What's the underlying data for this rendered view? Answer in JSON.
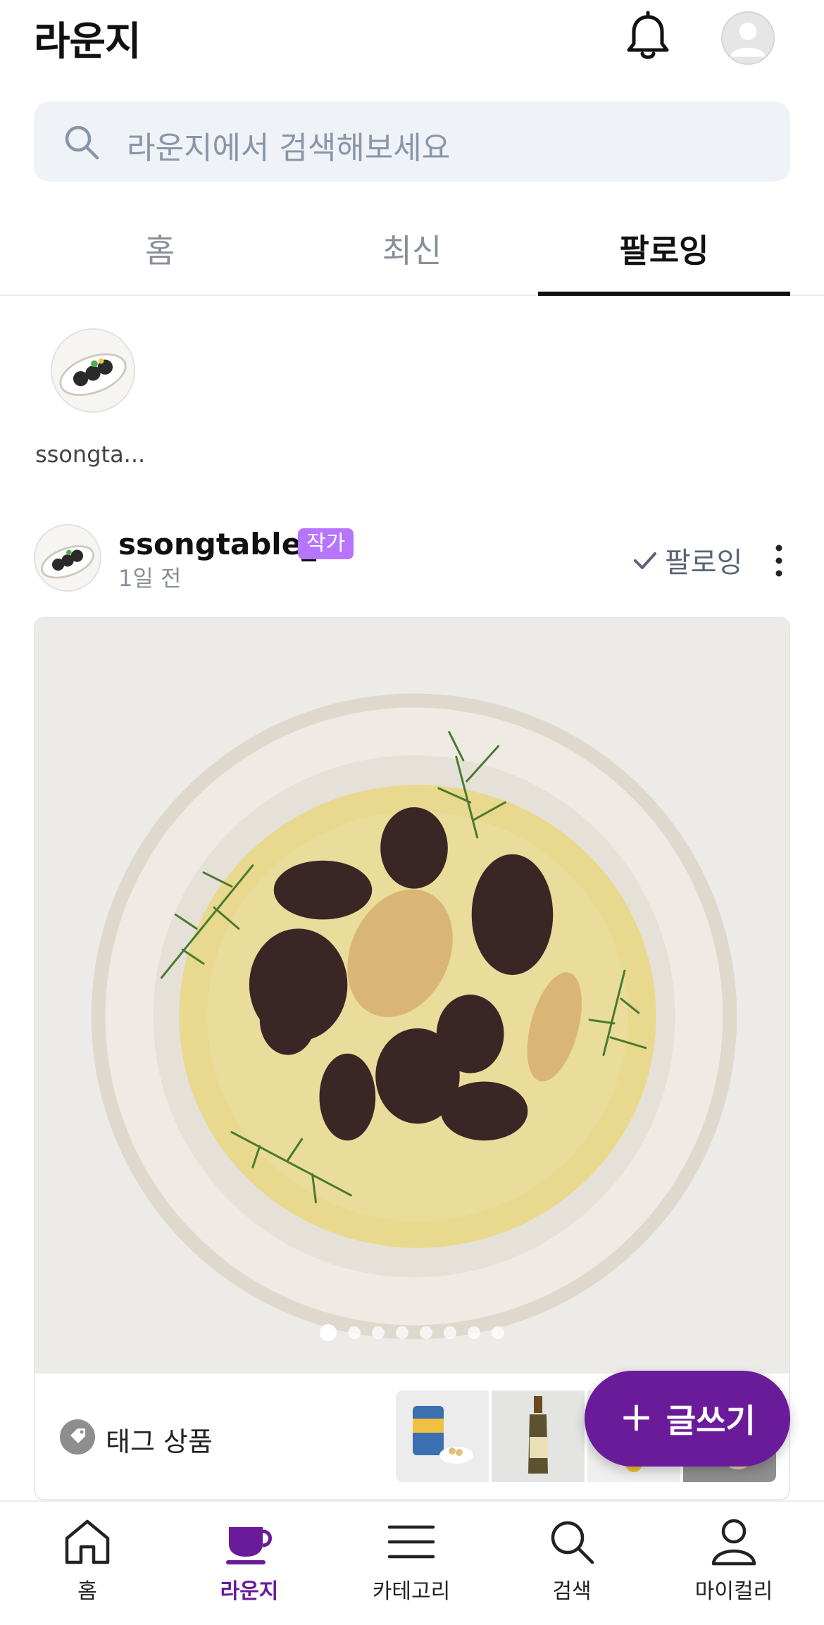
{
  "header": {
    "title": "라운지"
  },
  "search": {
    "placeholder": "라운지에서 검색해보세요"
  },
  "tabs": [
    {
      "label": "홈",
      "active": false
    },
    {
      "label": "최신",
      "active": false
    },
    {
      "label": "팔로잉",
      "active": true
    }
  ],
  "stories": [
    {
      "name": "ssongta..."
    }
  ],
  "post": {
    "username": "ssongtable_",
    "badge": "작가",
    "time": "1일 전",
    "follow_label": "팔로잉",
    "image_count": 8,
    "current_image": 1,
    "tag_label": "태그 상품"
  },
  "write_button": {
    "label": "글쓰기"
  },
  "bottom_nav": [
    {
      "label": "홈",
      "icon": "home-icon",
      "active": false
    },
    {
      "label": "라운지",
      "icon": "coffee-cup-icon",
      "active": true
    },
    {
      "label": "카테고리",
      "icon": "menu-icon",
      "active": false
    },
    {
      "label": "검색",
      "icon": "search-icon",
      "active": false
    },
    {
      "label": "마이컬리",
      "icon": "person-icon",
      "active": false
    }
  ],
  "colors": {
    "accent": "#6a1b9a",
    "badge": "#b774ff",
    "search_bg": "#eff2f7"
  }
}
